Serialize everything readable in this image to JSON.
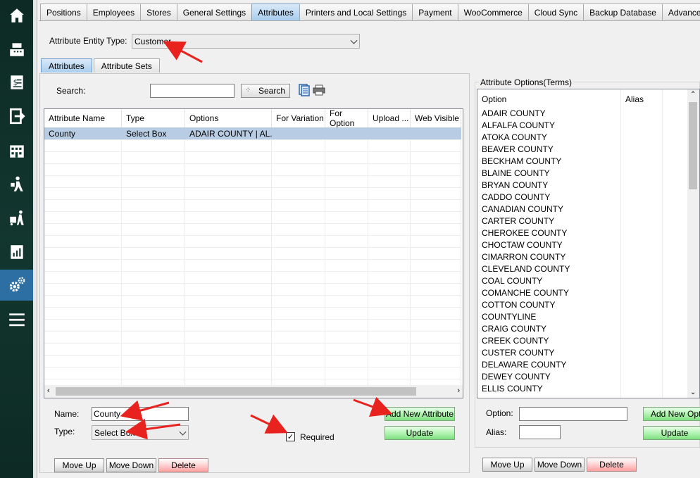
{
  "sidebar": {
    "items": [
      "home-icon",
      "cash-register-icon",
      "invoice-icon",
      "logout-icon",
      "store-icon",
      "delivery-icon",
      "hand-truck-icon",
      "report-icon",
      "settings-icon",
      "menu-icon"
    ]
  },
  "tabs": [
    "Positions",
    "Employees",
    "Stores",
    "General Settings",
    "Attributes",
    "Printers and Local Settings",
    "Payment",
    "WooCommerce",
    "Cloud Sync",
    "Backup Database",
    "Advanced"
  ],
  "active_tab": "Attributes",
  "entity": {
    "label": "Attribute Entity Type:",
    "value": "Customer"
  },
  "subtabs": [
    "Attributes",
    "Attribute Sets"
  ],
  "search": {
    "label": "Search:",
    "value": "",
    "button": "Search"
  },
  "grid": {
    "columns": [
      "Attribute Name",
      "Type",
      "Options",
      "For Variation",
      "For Option",
      "Upload ...",
      "Web Visible"
    ],
    "rows": [
      [
        "County",
        "Select Box",
        "ADAIR COUNTY | AL...",
        "",
        "",
        "",
        ""
      ]
    ]
  },
  "form": {
    "name_label": "Name:",
    "name_value": "County",
    "type_label": "Type:",
    "type_value": "Select Box",
    "required_label": "Required",
    "required_checked": true
  },
  "buttons": {
    "add_attribute": "Add New Attribute",
    "update": "Update",
    "move_up": "Move Up",
    "move_down": "Move Down",
    "delete": "Delete"
  },
  "options": {
    "group_title": "Attribute Options(Terms)",
    "col_option": "Option",
    "col_alias": "Alias",
    "items": [
      "ADAIR COUNTY",
      "ALFALFA COUNTY",
      "ATOKA COUNTY",
      "BEAVER COUNTY",
      "BECKHAM COUNTY",
      "BLAINE COUNTY",
      "BRYAN COUNTY",
      "CADDO COUNTY",
      "CANADIAN COUNTY",
      "CARTER COUNTY",
      "CHEROKEE COUNTY",
      "CHOCTAW COUNTY",
      "CIMARRON COUNTY",
      "CLEVELAND COUNTY",
      "COAL COUNTY",
      "COMANCHE COUNTY",
      "COTTON COUNTY",
      "COUNTYLINE",
      "CRAIG COUNTY",
      "CREEK COUNTY",
      "CUSTER COUNTY",
      "DELAWARE COUNTY",
      "DEWEY COUNTY",
      "ELLIS COUNTY"
    ],
    "option_label": "Option:",
    "alias_label": "Alias:",
    "add_button": "Add New Optio",
    "update_button": "Update",
    "move_up": "Move Up",
    "move_down": "Move Down",
    "delete": "Delete"
  }
}
